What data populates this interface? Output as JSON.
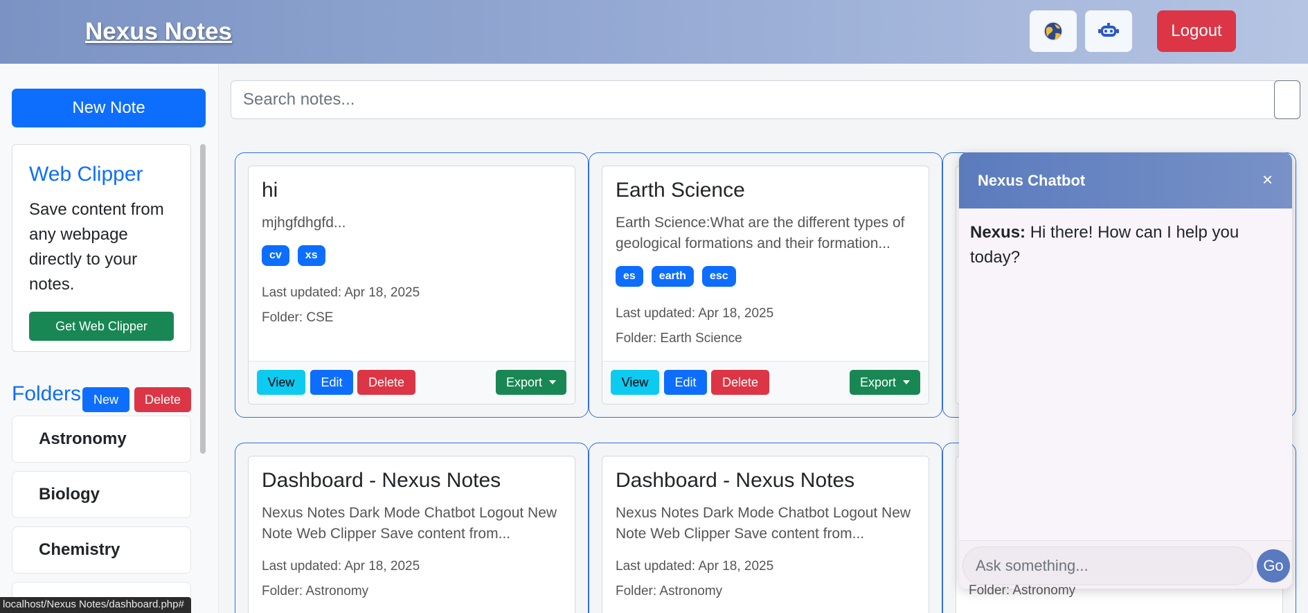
{
  "header": {
    "brand": "Nexus Notes",
    "dark_mode_icon": "globe-icon",
    "chatbot_icon": "robot-icon",
    "logout_label": "Logout"
  },
  "sidebar": {
    "new_note_label": "New Note",
    "clipper": {
      "title": "Web Clipper",
      "text": "Save content from any webpage directly to your notes.",
      "button": "Get Web Clipper"
    },
    "folders_title": "Folders",
    "folder_new_label": "New",
    "folder_delete_label": "Delete",
    "folders": [
      "Astronomy",
      "Biology",
      "Chemistry"
    ]
  },
  "search": {
    "placeholder": "Search notes..."
  },
  "notes": [
    {
      "title": "hi",
      "preview": "mjhgfdhgfd...",
      "tags": [
        "cv",
        "xs"
      ],
      "updated": "Last updated: Apr 18, 2025",
      "folder": "Folder: CSE"
    },
    {
      "title": "Earth Science",
      "preview": "Earth Science:What are the different types of geological formations and their formation...",
      "tags": [
        "es",
        "earth",
        "esc"
      ],
      "updated": "Last updated: Apr 18, 2025",
      "folder": "Folder: Earth Science"
    },
    {
      "title": "Dashboard - Nexus Notes",
      "preview": "Nexus Notes Dark Mode Chatbot Logout New Note Web Clipper Save content from...",
      "tags": [],
      "updated": "Last updated: Apr 18, 2025",
      "folder": "Folder: Astronomy"
    },
    {
      "title": "Dashboard - Nexus Notes",
      "preview": "Nexus Notes Dark Mode Chatbot Logout New Note Web Clipper Save content from...",
      "tags": [],
      "updated": "Last updated: Apr 18, 2025",
      "folder": "Folder: Astronomy"
    }
  ],
  "card_actions": {
    "view": "View",
    "edit": "Edit",
    "delete": "Delete",
    "export": "Export"
  },
  "chatbot": {
    "title": "Nexus Chatbot",
    "close": "×",
    "sender": "Nexus:",
    "message": " Hi there! How can I help you today?",
    "input_placeholder": "Ask something...",
    "go_label": "Go",
    "behind_text": "Folder: Astronomy"
  },
  "statusbar": {
    "url": "localhost/Nexus Notes/dashboard.php#"
  },
  "colors": {
    "primary": "#0d6efd",
    "danger": "#dc3545",
    "success": "#198754",
    "info": "#0dcaf0"
  }
}
